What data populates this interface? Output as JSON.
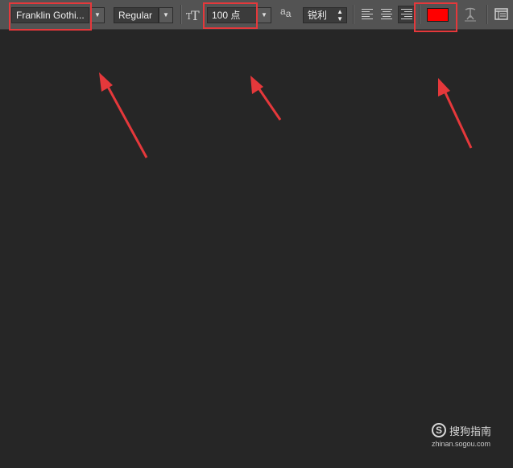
{
  "toolbar": {
    "font_family": "Franklin Gothi...",
    "font_style": "Regular",
    "font_size": "100 点",
    "antialias": "锐利",
    "antialias_prefix": "a",
    "antialias_suffix": "a",
    "text_color": "#ff0000",
    "size_icon_glyph": "T"
  },
  "highlight_color": "#e5383b",
  "watermark": {
    "title": "搜狗指南",
    "url": "zhinan.sogou.com",
    "logo": "S"
  },
  "icons": [
    "font-size-icon",
    "antialias-icon",
    "align-left-icon",
    "align-center-icon",
    "align-right-icon",
    "warp-text-icon",
    "panel-toggle-icon",
    "dropdown-arrow-icon"
  ]
}
